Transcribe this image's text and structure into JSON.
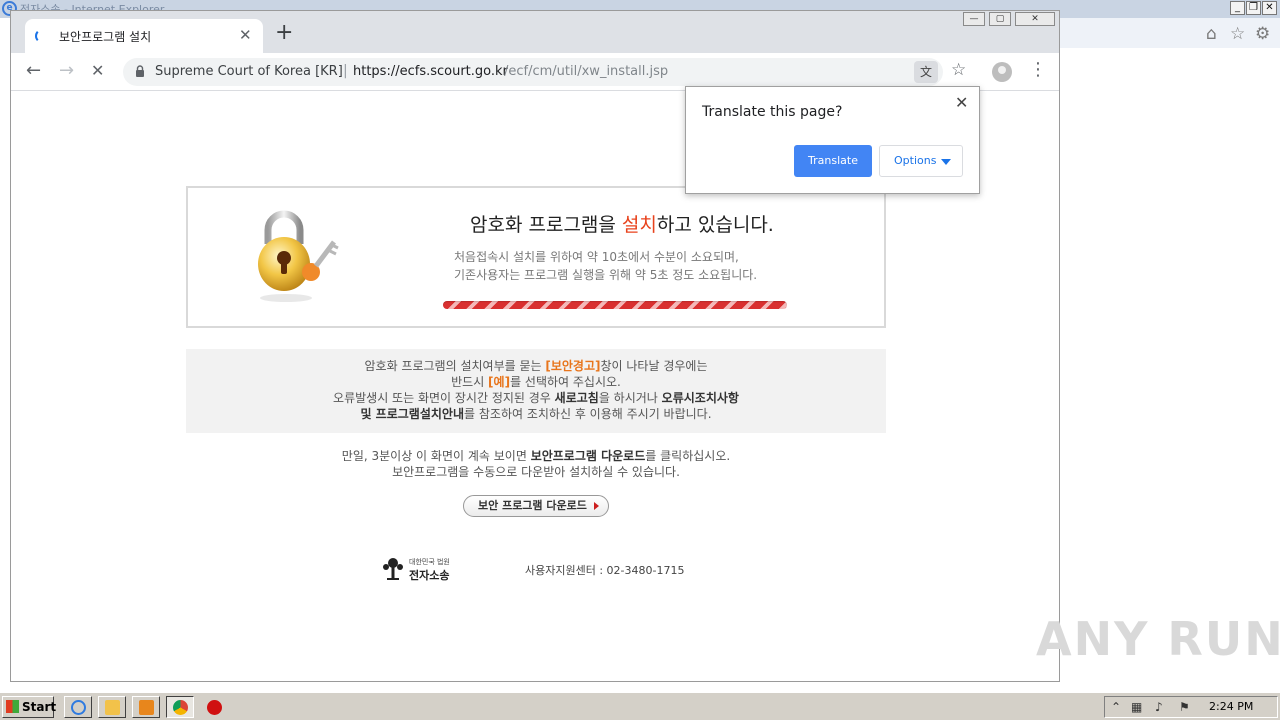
{
  "ie_window": {
    "title": "전자소송 - Internet Explorer"
  },
  "chrome": {
    "tab_title": "보안프로그램 설치",
    "url": {
      "site_name": "Supreme Court of Korea [KR]",
      "separator": "|",
      "host": "https://ecfs.scourt.go.kr",
      "path": "/ecf/cm/util/xw_install.jsp"
    }
  },
  "translate_popup": {
    "question": "Translate this page?",
    "translate_label": "Translate",
    "options_label": "Options"
  },
  "page": {
    "heading_before": "암호화 프로그램을 ",
    "heading_highlight": "설치",
    "heading_after": "하고 있습니다.",
    "desc_line1": "처음접속시 설치를 위하여 약 10초에서 수분이 소요되며,",
    "desc_line2": "기존사용자는 프로그램 실행을 위해 약 5초 정도 소요됩니다.",
    "notice": {
      "line1_before": "암호화 프로그램의 설치여부를 묻는 ",
      "line1_highlight": "[보안경고]",
      "line1_after": "창이 나타날 경우에는",
      "line2_before": "반드시 ",
      "line2_highlight": "[예]",
      "line2_after": "를 선택하여 주십시오.",
      "line3_before": "오류발생시 또는 화면이 장시간 정지된 경우 ",
      "line3_bold1": "새로고침",
      "line3_mid": "을 하시거나 ",
      "line3_bold2": "오류시조치사항",
      "line4_bold": "및 프로그램설치안내",
      "line4_after": "를 참조하여 조치하신 후 이용해 주시기 바랍니다."
    },
    "manual": {
      "line1_before": "만일, 3분이상 이 화면이 계속 보이면 ",
      "line1_bold": "보안프로그램 다운로드",
      "line1_after": "를 클릭하십시오.",
      "line2": "보안프로그램을 수동으로 다운받아 설치하실 수 있습니다."
    },
    "download_button": "보안 프로그램 다운로드",
    "logo_sub": "대한민국 법원",
    "logo_main": "전자소송",
    "support_center": "사용자지원센터 : 02-3480-1715"
  },
  "watermark": "ANY RUN",
  "taskbar": {
    "start_label": "Start",
    "clock": "2:24 PM"
  },
  "icons": {
    "ie_home": "home-icon",
    "ie_favorites": "star-icon",
    "ie_tools": "gear-icon",
    "chrome_back": "back-arrow-icon",
    "chrome_forward": "forward-arrow-icon",
    "chrome_stop": "stop-icon",
    "lock": "lock-icon",
    "translate": "translate-icon",
    "bookmark": "star-icon",
    "profile": "profile-icon",
    "menu": "kebab-menu-icon"
  },
  "colors": {
    "accent_red": "#e8421c",
    "accent_orange": "#e8751c",
    "translate_blue": "#4285f4"
  }
}
